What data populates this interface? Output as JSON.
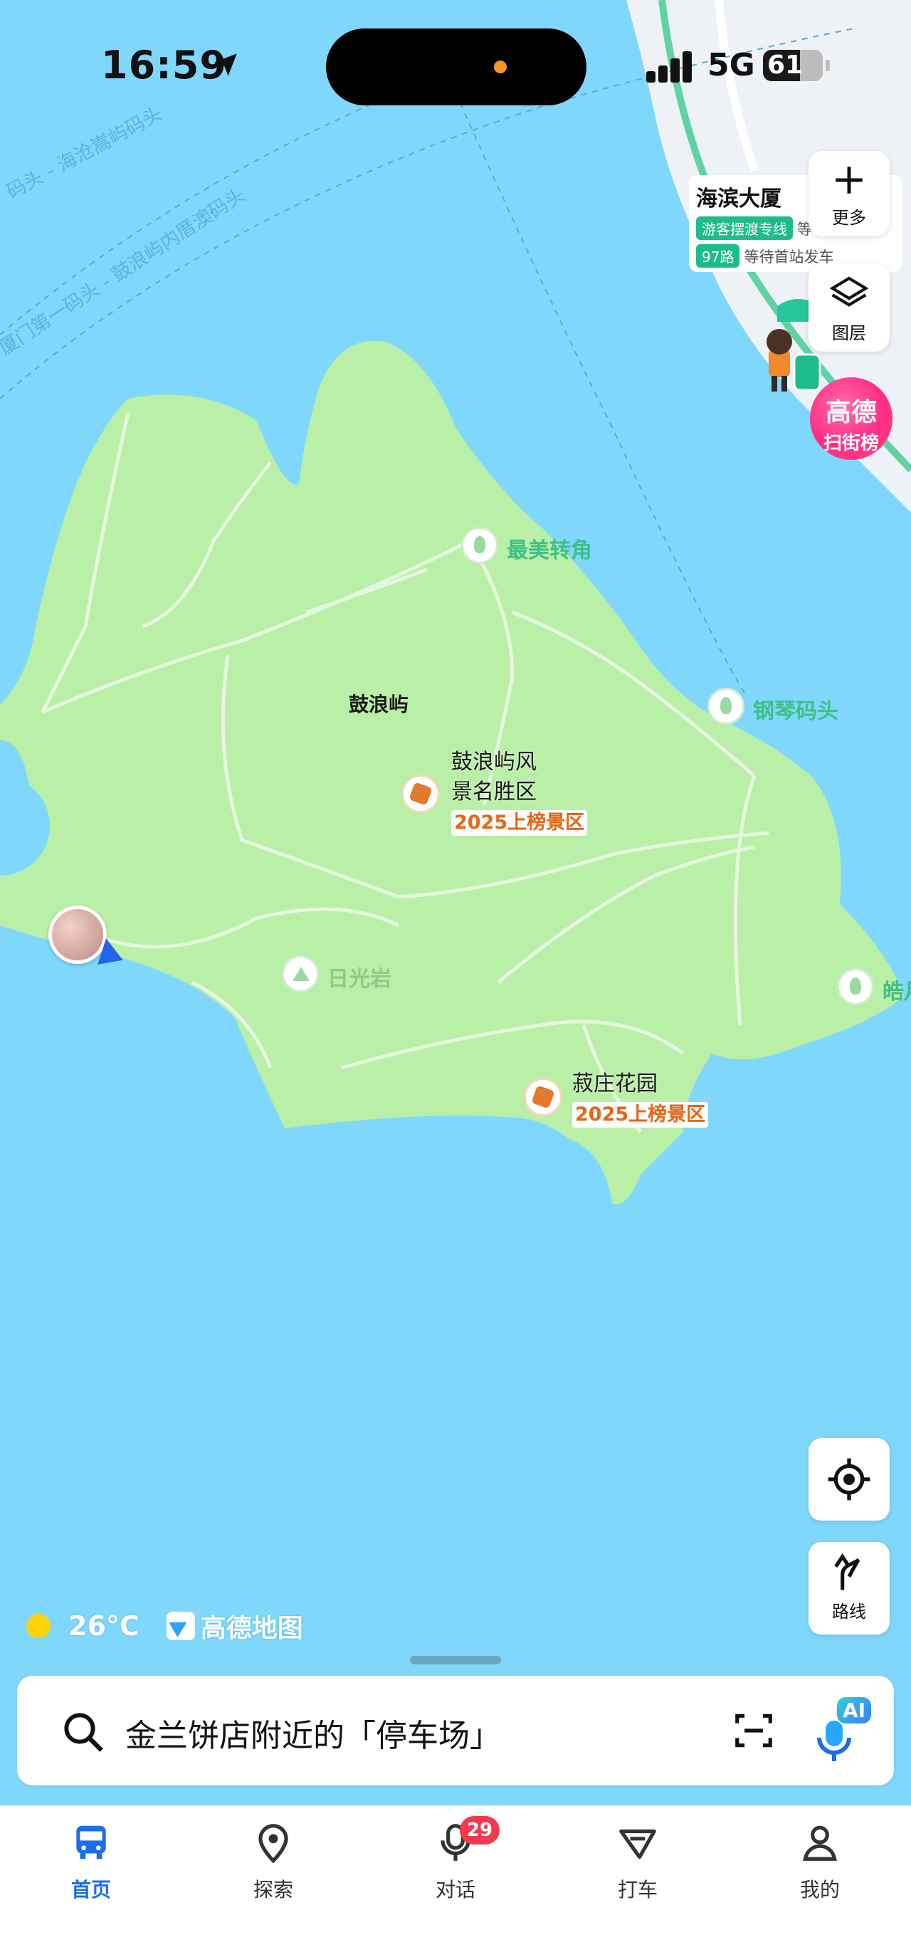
{
  "status_bar": {
    "time": "16:59",
    "network": "5G",
    "battery": "61"
  },
  "map": {
    "island_name": "鼓浪屿",
    "road_labels": [
      "码头 - 海沧嵩屿码头",
      "厦门第一码头 - 鼓浪屿内厝澳码头"
    ],
    "stop_card": {
      "title": "海滨大厦",
      "tags": [
        "游客摆渡专线",
        "97路"
      ],
      "note1": "等",
      "note2": "等待首站发车",
      "edge": "车"
    },
    "pois": [
      {
        "label": "最美转角",
        "icon": "tree-icon"
      },
      {
        "label": "钢琴码头",
        "icon": "tree-icon"
      },
      {
        "label": "日光岩",
        "icon": "mountain-icon"
      },
      {
        "label": "皓月",
        "icon": "tree-icon"
      }
    ],
    "scenic_spots": [
      {
        "line1": "鼓浪屿风",
        "line2": "景名胜区",
        "rank": "2025上榜景区"
      },
      {
        "line1": "菽庄花园",
        "line2": "",
        "rank": "2025上榜景区"
      }
    ],
    "colors": {
      "water": "#7fd8fb",
      "land": "#b9efa6",
      "path": "#e6f7e0",
      "accent": "#1b6ee8"
    }
  },
  "controls": {
    "more": "更多",
    "layers": "图层",
    "gaode_line1": "高德",
    "gaode_line2": "扫街榜",
    "route": "路线"
  },
  "weather": {
    "temp": "26°C",
    "brand": "高德地图"
  },
  "search": {
    "query": "金兰饼店附近的「停车场」",
    "ai": "AI"
  },
  "tabs": [
    {
      "label": "首页",
      "active": true
    },
    {
      "label": "探索"
    },
    {
      "label": "对话",
      "badge": "29"
    },
    {
      "label": "打车"
    },
    {
      "label": "我的"
    }
  ]
}
